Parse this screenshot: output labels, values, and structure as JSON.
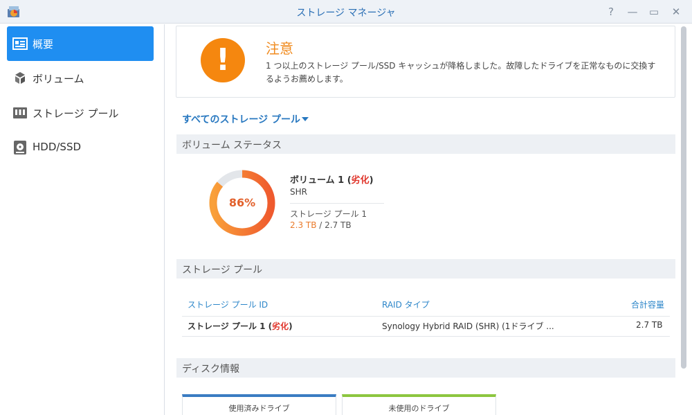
{
  "window": {
    "title": "ストレージ マネージャ",
    "help": "?",
    "minimize": "—",
    "maximize": "▭",
    "close": "✕"
  },
  "sidebar": {
    "items": [
      {
        "label": "概要",
        "icon": "overview-icon",
        "active": true
      },
      {
        "label": "ボリューム",
        "icon": "volume-icon"
      },
      {
        "label": "ストレージ プール",
        "icon": "storage-pool-icon"
      },
      {
        "label": "HDD/SSD",
        "icon": "hdd-icon"
      }
    ]
  },
  "notice": {
    "symbol": "!",
    "title": "注意",
    "message": "1 つ以上のストレージ プール/SSD キャッシュが降格しました。故障したドライブを正常なものに交換するようお薦めします。"
  },
  "pool_filter": {
    "label": "すべてのストレージ プール"
  },
  "volume_status": {
    "header": "ボリューム ステータス",
    "usage_percent": 86,
    "usage_label": "86%",
    "volume_name": "ボリューム 1",
    "status_open": " (",
    "status": "劣化",
    "status_close": ")",
    "raid_type": "SHR",
    "pool_name": "ストレージ プール 1",
    "used": "2.3 TB",
    "usage_separator": " / ",
    "total": "2.7 TB"
  },
  "storage_pool": {
    "header": "ストレージ プール",
    "columns": [
      "ストレージ プール ID",
      "RAID タイプ",
      "合計容量"
    ],
    "rows": [
      {
        "id": "ストレージ プール 1",
        "status_open": " (",
        "status": "劣化",
        "status_close": ")",
        "raid": "Synology Hybrid RAID (SHR) (1ドライブ ...",
        "capacity": "2.7 TB"
      }
    ]
  },
  "disk_info": {
    "header": "ディスク情報",
    "cards": [
      {
        "label": "使用済みドライブ",
        "color": "#3a7cc2"
      },
      {
        "label": "未使用のドライブ",
        "color": "#8cc63f"
      }
    ]
  },
  "colors": {
    "accent": "#1f8ef1",
    "warning": "#f5870f",
    "degraded": "#e0352b",
    "link": "#2878c0"
  }
}
